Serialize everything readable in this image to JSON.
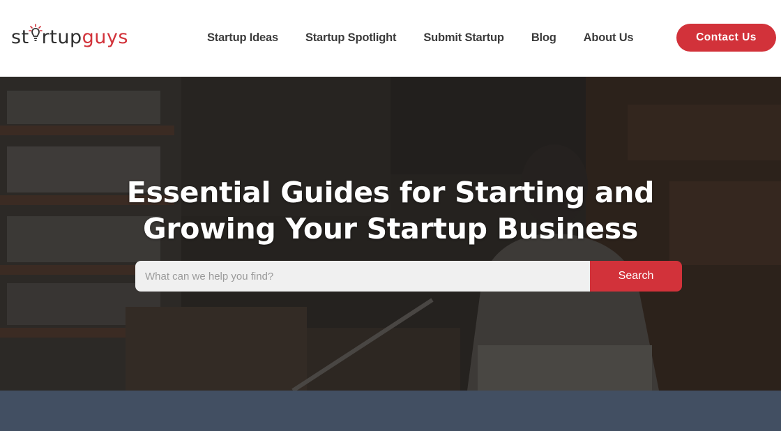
{
  "header": {
    "logo": {
      "part1": "st",
      "part2": "rtup",
      "part3": "guys"
    },
    "nav": [
      {
        "label": "Startup Ideas"
      },
      {
        "label": "Startup Spotlight"
      },
      {
        "label": "Submit Startup"
      },
      {
        "label": "Blog"
      },
      {
        "label": "About Us"
      }
    ],
    "contact_label": "Contact Us"
  },
  "hero": {
    "title_line1": "Essential Guides for Starting and",
    "title_line2": "Growing Your Startup Business",
    "search": {
      "placeholder": "What can we help you find?",
      "value": "",
      "button_label": "Search"
    }
  },
  "colors": {
    "brand_red": "#d2323a",
    "nav_text": "#3b3b3b",
    "band": "#424f62"
  },
  "icons": {
    "logo_bulb": "lightbulb-icon"
  }
}
